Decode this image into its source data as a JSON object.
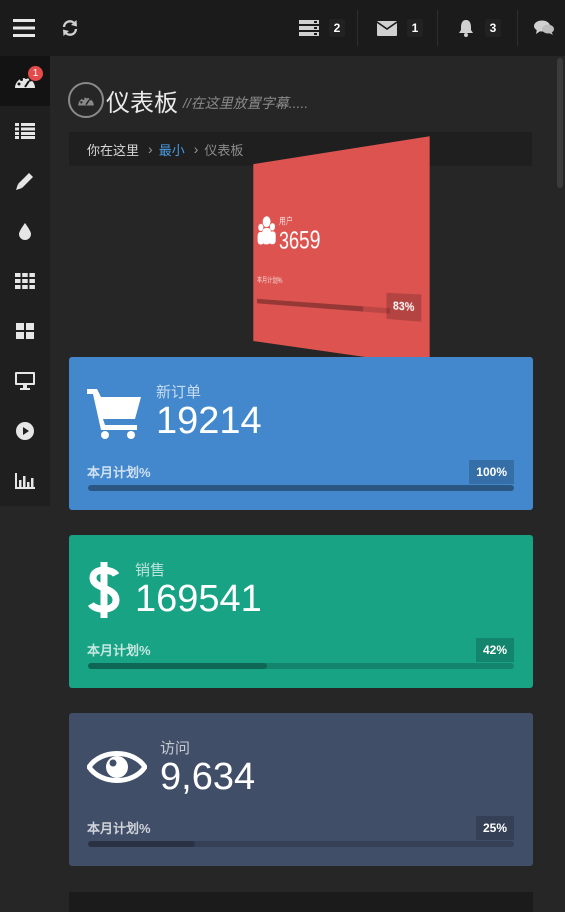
{
  "topbar": {
    "servers_count": "2",
    "mail_count": "1",
    "bell_count": "3"
  },
  "sidebar": {
    "dashboard_badge": "1"
  },
  "page": {
    "title": "仪表板",
    "subtitle": "//在这里放置字幕....."
  },
  "breadcrumb": {
    "here": "你在这里",
    "item1": "最小",
    "item2": "仪表板"
  },
  "flip_card": {
    "label": "用户",
    "value": "3659",
    "plan": "本月计划%",
    "percent": "83%",
    "progress": 0.83,
    "color": "#dc5350"
  },
  "stats": [
    {
      "label": "新订单",
      "value": "19214",
      "plan": "本月计划%",
      "percent": "100%",
      "progress": 1.0,
      "color": "#4388cd",
      "icon": "shopping-cart-icon"
    },
    {
      "label": "销售",
      "value": "169541",
      "plan": "本月计划%",
      "percent": "42%",
      "progress": 0.42,
      "color": "#18a385",
      "icon": "dollar-icon"
    },
    {
      "label": "访问",
      "value": "9,634",
      "plan": "本月计划%",
      "percent": "25%",
      "progress": 0.25,
      "color": "#414e68",
      "icon": "eye-icon"
    }
  ]
}
